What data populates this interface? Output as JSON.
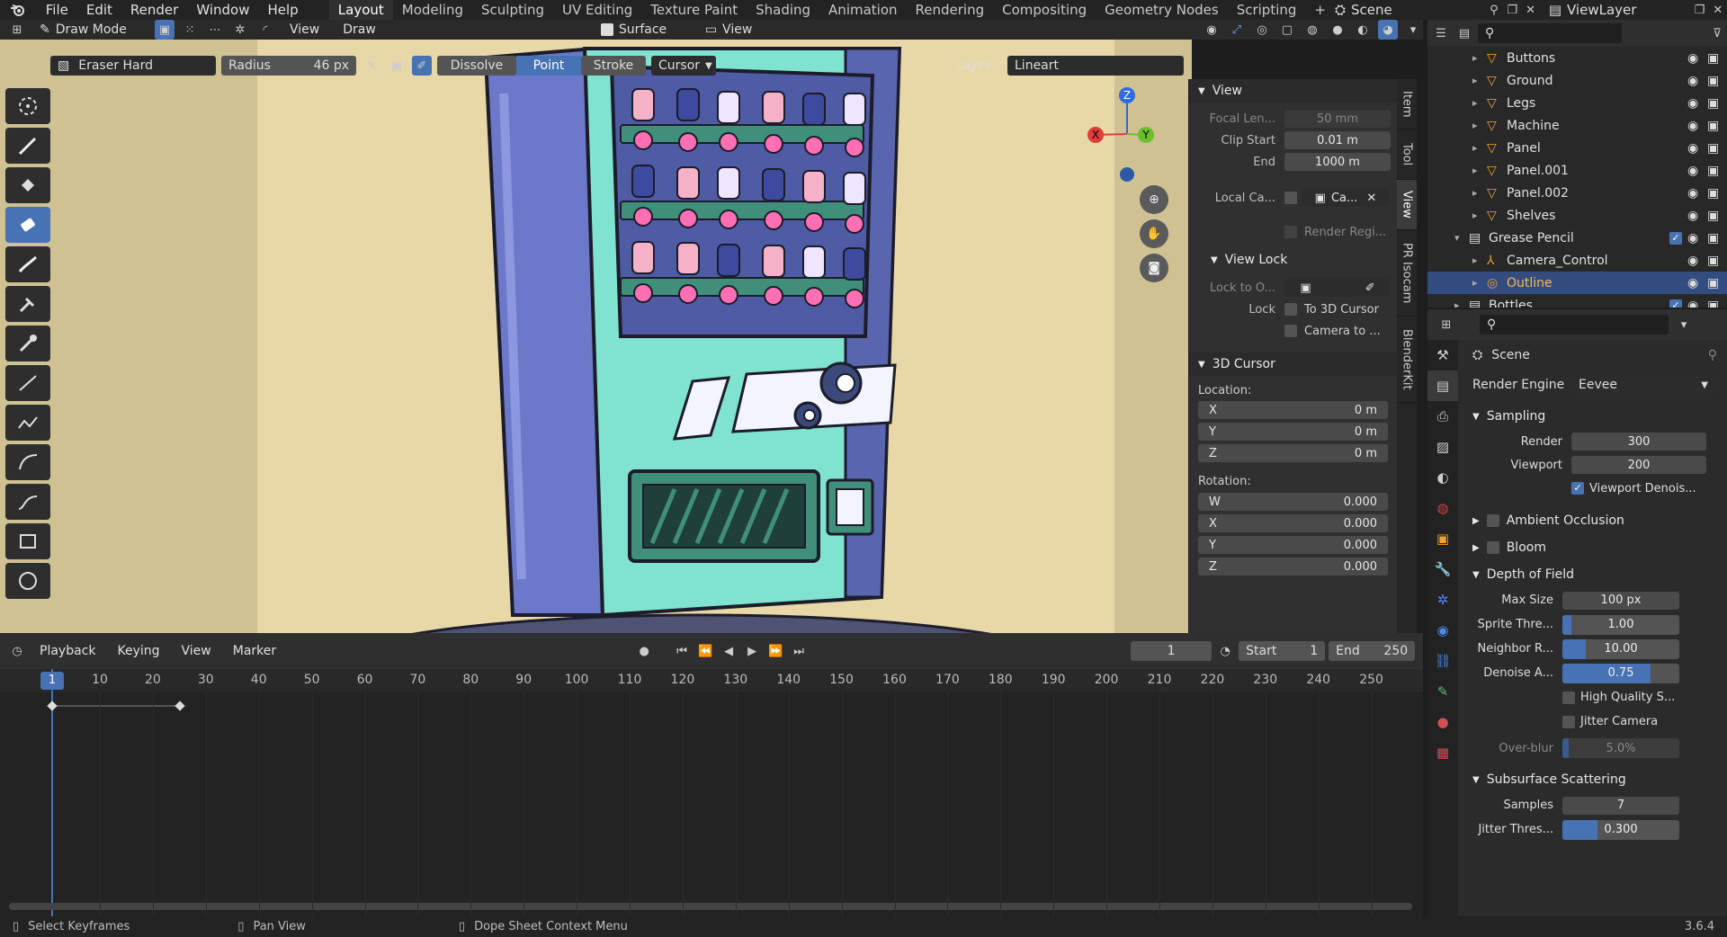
{
  "menu": {
    "items": [
      "File",
      "Edit",
      "Render",
      "Window",
      "Help"
    ]
  },
  "workspaces": [
    "Layout",
    "Modeling",
    "Sculpting",
    "UV Editing",
    "Texture Paint",
    "Shading",
    "Animation",
    "Rendering",
    "Compositing",
    "Geometry Nodes",
    "Scripting"
  ],
  "active_workspace": "Layout",
  "scene_name": "Scene",
  "view_layer": "ViewLayer",
  "viewport_header": {
    "mode": "Draw Mode",
    "view_menu": "View",
    "draw_menu": "Draw",
    "surface": "Surface",
    "view_dropdown": "View"
  },
  "tool_settings": {
    "brush": "Eraser Hard",
    "radius_label": "Radius",
    "radius_value": "46 px",
    "dissolve": "Dissolve",
    "point": "Point",
    "stroke": "Stroke",
    "cursor": "Cursor",
    "layer_label": "Layer:",
    "layer_value": "Lineart"
  },
  "npanel": {
    "view_title": "View",
    "focal_label": "Focal Len...",
    "focal_value": "50 mm",
    "clip_start_label": "Clip Start",
    "clip_start_value": "0.01 m",
    "clip_end_label": "End",
    "clip_end_value": "1000 m",
    "local_cam_label": "Local Ca...",
    "local_cam_value": "Ca...",
    "render_region": "Render Regi...",
    "view_lock_title": "View Lock",
    "lock_to_label": "Lock to O...",
    "lock_label": "Lock",
    "to_3d_cursor": "To 3D Cursor",
    "camera_to": "Camera to ...",
    "cursor_title": "3D Cursor",
    "location_label": "Location:",
    "loc": [
      {
        "axis": "X",
        "value": "0 m"
      },
      {
        "axis": "Y",
        "value": "0 m"
      },
      {
        "axis": "Z",
        "value": "0 m"
      }
    ],
    "rotation_label": "Rotation:",
    "rot": [
      {
        "axis": "W",
        "value": "0.000"
      },
      {
        "axis": "X",
        "value": "0.000"
      },
      {
        "axis": "Y",
        "value": "0.000"
      },
      {
        "axis": "Z",
        "value": "0.000"
      }
    ],
    "tabs": [
      "Item",
      "Tool",
      "View",
      "PR Isocam",
      "BlenderKit"
    ],
    "active_tab": "View"
  },
  "gizmo": {
    "x": "X",
    "y": "Y",
    "z": "Z"
  },
  "timeline": {
    "playback": "Playback",
    "keying": "Keying",
    "view": "View",
    "marker": "Marker",
    "current_frame": "1",
    "start_label": "Start",
    "start_value": "1",
    "end_label": "End",
    "end_value": "250",
    "ticks": [
      "1",
      "10",
      "20",
      "30",
      "40",
      "50",
      "60",
      "70",
      "80",
      "90",
      "100",
      "110",
      "120",
      "130",
      "140",
      "150",
      "160",
      "170",
      "180",
      "190",
      "200",
      "210",
      "220",
      "230",
      "240",
      "250"
    ]
  },
  "outliner": {
    "rows": [
      {
        "name": "Buttons",
        "indent": 2,
        "type": "obj"
      },
      {
        "name": "Ground",
        "indent": 2,
        "type": "obj"
      },
      {
        "name": "Legs",
        "indent": 2,
        "type": "obj"
      },
      {
        "name": "Machine",
        "indent": 2,
        "type": "obj"
      },
      {
        "name": "Panel",
        "indent": 2,
        "type": "obj"
      },
      {
        "name": "Panel.001",
        "indent": 2,
        "type": "obj"
      },
      {
        "name": "Panel.002",
        "indent": 2,
        "type": "obj"
      },
      {
        "name": "Shelves",
        "indent": 2,
        "type": "obj"
      },
      {
        "name": "Grease Pencil",
        "indent": 1,
        "type": "coll"
      },
      {
        "name": "Camera_Control",
        "indent": 2,
        "type": "arm"
      },
      {
        "name": "Outline",
        "indent": 2,
        "type": "gp"
      },
      {
        "name": "Bottles",
        "indent": 1,
        "type": "coll"
      }
    ]
  },
  "properties": {
    "context": "Scene",
    "render_engine_label": "Render Engine",
    "render_engine_value": "Eevee",
    "sampling": "Sampling",
    "render_label": "Render",
    "render_value": "300",
    "viewport_label": "Viewport",
    "viewport_value": "200",
    "viewport_denoise": "Viewport Denois...",
    "ambient_occlusion": "Ambient Occlusion",
    "bloom": "Bloom",
    "depth_of_field": "Depth of Field",
    "max_size_label": "Max Size",
    "max_size_value": "100 px",
    "sprite_label": "Sprite Thre...",
    "sprite_value": "1.00",
    "neighbor_label": "Neighbor R...",
    "neighbor_value": "10.00",
    "denoise_label": "Denoise A...",
    "denoise_value": "0.75",
    "high_quality": "High Quality S...",
    "jitter_camera": "Jitter Camera",
    "overblur_label": "Over-blur",
    "overblur_value": "5.0%",
    "sss": "Subsurface Scattering",
    "samples_label": "Samples",
    "samples_value": "7",
    "jitter_thresh_label": "Jitter Thres...",
    "jitter_thresh_value": "0.300"
  },
  "status": {
    "select_keyframes": "Select Keyframes",
    "pan_view": "Pan View",
    "context_menu": "Dope Sheet Context Menu",
    "version": "3.6.4"
  }
}
